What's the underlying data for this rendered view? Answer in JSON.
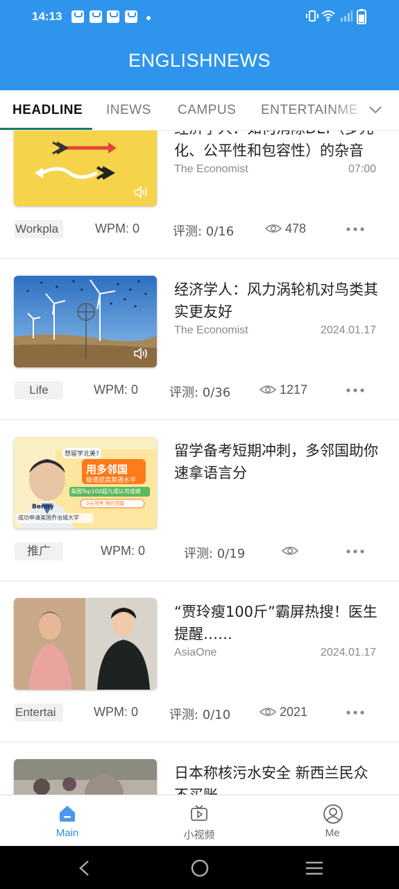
{
  "status_bar": {
    "time": "14:13"
  },
  "app": {
    "title": "ENGLISHNEWS"
  },
  "tabs": [
    {
      "label": "HEADLINE",
      "active": true
    },
    {
      "label": "INEWS",
      "active": false
    },
    {
      "label": "CAMPUS",
      "active": false
    },
    {
      "label": "ENTERTAINME",
      "active": false
    }
  ],
  "feed": [
    {
      "headline": "经济学人：如何消除DEI（多元化、公平性和包容性）的杂音",
      "source": "The Economist",
      "date": "07:00",
      "tag": "Workpla",
      "wpm": "WPM: 0",
      "score": "评测: 0/16",
      "views": "478",
      "has_audio": true
    },
    {
      "headline": "经济学人：风力涡轮机对鸟类其实更友好",
      "source": "The Economist",
      "date": "2024.01.17",
      "tag": "Life",
      "wpm": "WPM: 0",
      "score": "评测: 0/36",
      "views": "1217",
      "has_audio": true
    },
    {
      "headline": "留学备考短期冲刺，多邻国助你速拿语言分",
      "source": "",
      "date": "",
      "tag": "推广",
      "wpm": "WPM: 0",
      "score": "评测: 0/19",
      "views": "",
      "has_audio": false,
      "ad_text": {
        "bubble": "想留学北美?",
        "main": "用多邻国",
        "sub": "极速提高英语水平",
        "banner": "美国Top100超九成认可成绩",
        "pill": "0元领考 限时领取",
        "name": "Benny",
        "caption": "成功申请美国乔治城大学"
      }
    },
    {
      "headline": "“贾玲瘦100斤”霸屏热搜！医生提醒……",
      "source": "AsiaOne",
      "date": "2024.01.17",
      "tag": "Entertai",
      "wpm": "WPM: 0",
      "score": "评测: 0/10",
      "views": "2021",
      "has_audio": false
    },
    {
      "headline": "日本称核污水安全 新西兰民众不买账",
      "source": "",
      "date": "",
      "tag": "",
      "wpm": "",
      "score": "",
      "views": "",
      "has_audio": false
    }
  ],
  "bottom_nav": [
    {
      "label": "Main",
      "icon": "home-icon",
      "active": true
    },
    {
      "label": "小视频",
      "icon": "video-icon",
      "active": false
    },
    {
      "label": "Me",
      "icon": "profile-icon",
      "active": false
    }
  ],
  "colors": {
    "primary": "#2f95ec",
    "tab_indicator": "#1b7f5a",
    "active_nav": "#2f8de4"
  }
}
